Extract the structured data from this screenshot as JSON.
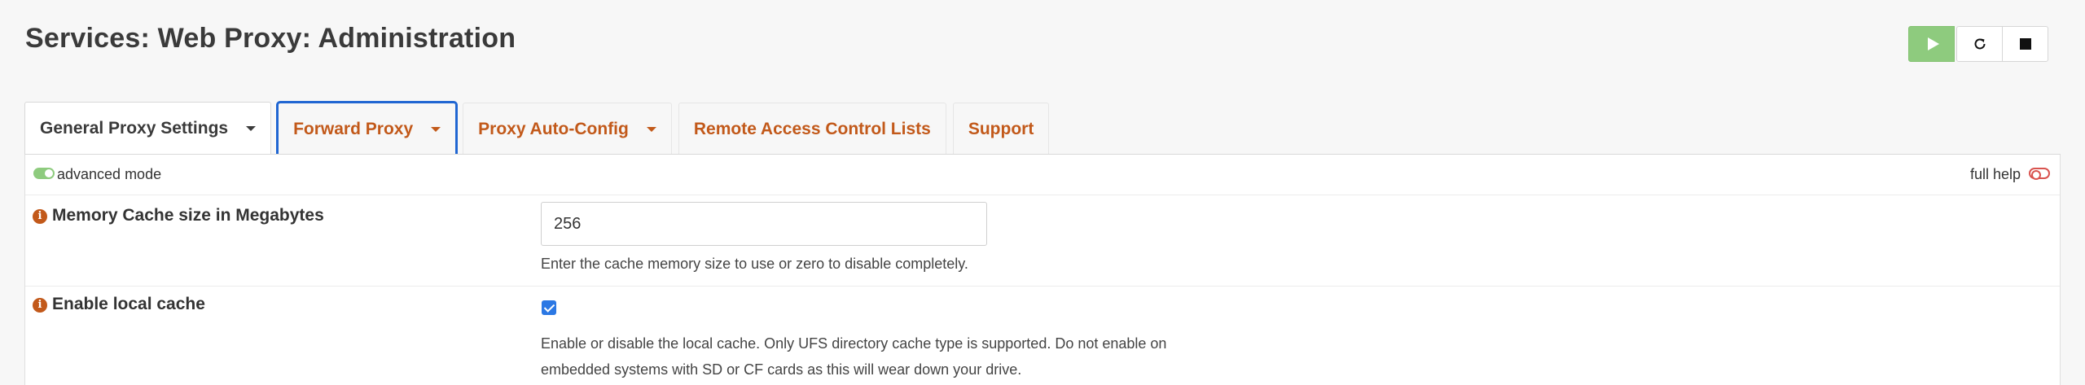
{
  "page": {
    "title": "Services: Web Proxy: Administration"
  },
  "service_controls": {
    "start_icon": "play-icon",
    "restart_icon": "restart-icon",
    "stop_icon": "stop-icon",
    "start_color": "#8ecb7e"
  },
  "tabs": [
    {
      "label": "General Proxy Settings",
      "has_dropdown": true,
      "active": true
    },
    {
      "label": "Forward Proxy",
      "has_dropdown": true,
      "active": false,
      "focused": true
    },
    {
      "label": "Proxy Auto-Config",
      "has_dropdown": true,
      "active": false
    },
    {
      "label": "Remote Access Control Lists",
      "has_dropdown": false,
      "active": false
    },
    {
      "label": "Support",
      "has_dropdown": false,
      "active": false
    }
  ],
  "toolbar": {
    "advanced_mode_label": "advanced mode",
    "advanced_mode_on": true,
    "full_help_label": "full help",
    "full_help_on": false
  },
  "fields": {
    "memory_cache": {
      "label": "Memory Cache size in Megabytes",
      "value": "256",
      "help": "Enter the cache memory size to use or zero to disable completely."
    },
    "local_cache": {
      "label": "Enable local cache",
      "checked": true,
      "help_line1": "Enable or disable the local cache. Only UFS directory cache type is supported. Do not enable on",
      "help_line2": "embedded systems with SD or CF cards as this will wear down your drive."
    }
  },
  "colors": {
    "accent": "#c2591a",
    "focus_outline": "#2066d2",
    "checkbox": "#2b78e4",
    "toggle_off": "#d9534f"
  }
}
